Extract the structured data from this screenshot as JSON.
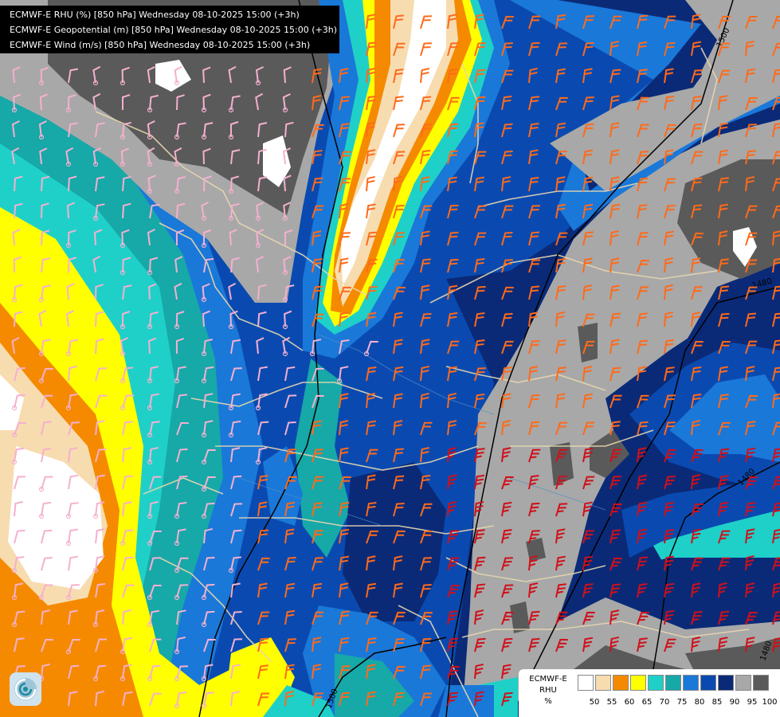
{
  "header": {
    "lines": [
      "ECMWF-E RHU (%) [850 hPa] Wednesday 08-10-2025 15:00 (+3h)",
      "ECMWF-E Geopotential (m) [850 hPa] Wednesday 08-10-2025 15:00 (+3h)",
      "ECMWF-E Wind (m/s) [850 hPa] Wednesday 08-10-2025 15:00 (+3h)"
    ]
  },
  "legend": {
    "title": "ECMWF-E",
    "variable": "RHU",
    "unit": "%",
    "ticks": [
      "50",
      "55",
      "60",
      "65",
      "70",
      "75",
      "80",
      "85",
      "90",
      "95",
      "100"
    ],
    "colors": [
      "#ffffff",
      "#f7dcb0",
      "#f58a00",
      "#ffff00",
      "#1fd0c8",
      "#17a8a8",
      "#1a78d8",
      "#0a4ab0",
      "#0a2a78",
      "#a8a8a8",
      "#5a5a5a"
    ]
  },
  "contour_labels": [
    "1500",
    "1480",
    "1480",
    "1500",
    "1480"
  ],
  "colors": {
    "rh_100": "#5a5a5a",
    "rh_95": "#a8a8a8",
    "rh_90": "#0a2a78",
    "rh_85": "#0a4ab0",
    "rh_80": "#1a78d8",
    "rh_75": "#17a8a8",
    "rh_70": "#1fd0c8",
    "rh_65": "#ffff00",
    "rh_60": "#f58a00",
    "rh_55": "#f7dcb0",
    "rh_50": "#ffffff",
    "border": "#e8d6b0",
    "contour": "#000000",
    "wind_weak": "#f5b0d0",
    "wind_moderate": "#ff6a1a",
    "wind_strong": "#d0101a"
  },
  "icons": [
    "ecmwf-logo-icon"
  ]
}
